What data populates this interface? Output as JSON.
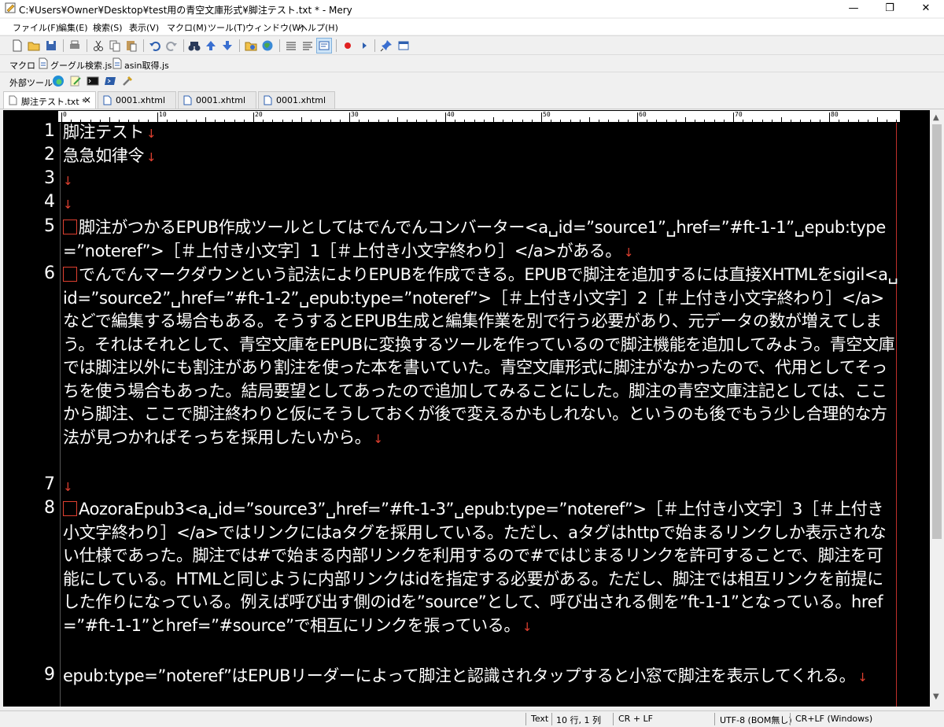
{
  "window": {
    "title": "C:¥Users¥Owner¥Desktop¥test用の青空文庫形式¥脚注テスト.txt * - Mery",
    "minimize": "—",
    "restore": "❐",
    "close": "✕"
  },
  "menu": [
    "ファイル(F)",
    "編集(E)",
    "検索(S)",
    "表示(V)",
    "マクロ(M)",
    "ツール(T)",
    "ウィンドウ(W)",
    "ヘルプ(H)"
  ],
  "macro_bar": {
    "label": "マクロ",
    "items": [
      "グーグル検索.js",
      "asin取得.js"
    ]
  },
  "ext_bar": {
    "label": "外部ツール"
  },
  "tabs": [
    {
      "label": "脚注テスト.txt *",
      "close": "×"
    },
    {
      "label": "0001.xhtml"
    },
    {
      "label": "0001.xhtml"
    },
    {
      "label": "0001.xhtml"
    }
  ],
  "ruler": {
    "labels": [
      "0",
      "10",
      "20",
      "30",
      "40",
      "50",
      "60",
      "70",
      "80"
    ]
  },
  "eol_mark": "↓",
  "lines": [
    {
      "num": "1",
      "text": "脚注テスト"
    },
    {
      "num": "2",
      "text": "急急如律令"
    },
    {
      "num": "3",
      "text": ""
    },
    {
      "num": "4",
      "text": ""
    },
    {
      "num": "5",
      "text": "脚注がつかるEPUB作成ツールとしてはでんでんコンバーター<a␣id=”source1”␣href=”#ft-1-1”␣epub:type=”noteref”>［＃上付き小文字］1［＃上付き小文字終わり］</a>がある。"
    },
    {
      "num": "6",
      "text": "でんでんマークダウンという記法によりEPUBを作成できる。EPUBで脚注を追加するには直接XHTMLをsigil<a␣id=”source2”␣href=”#ft-1-2”␣epub:type=”noteref”>［＃上付き小文字］2［＃上付き小文字終わり］</a>などで編集する場合もある。そうするとEPUB生成と編集作業を別で行う必要があり、元データの数が増えてしまう。それはそれとして、青空文庫をEPUBに変換するツールを作っているので脚注機能を追加してみよう。青空文庫では脚注以外にも割注があり割注を使った本を書いていた。青空文庫形式に脚注がなかったので、代用としてそっちを使う場合もあった。結局要望としてあったので追加してみることにした。脚注の青空文庫注記としては、ここから脚注、ここで脚注終わりと仮にそうしておくが後で変えるかもしれない。というのも後でもう少し合理的な方法が見つかればそっちを採用したいから。"
    },
    {
      "num": "7",
      "text": ""
    },
    {
      "num": "8",
      "text": "AozoraEpub3<a␣id=”source3”␣href=”#ft-1-3”␣epub:type=”noteref”>［＃上付き小文字］3［＃上付き小文字終わり］</a>ではリンクにはaタグを採用している。ただし、aタグはhttpで始まるリンクしか表示されない仕様であった。脚注では#で始まる内部リンクを利用するので#ではじまるリンクを許可することで、脚注を可能にしている。HTMLと同じように内部リンクはidを指定する必要がある。ただし、脚注では相互リンクを前提にした作りになっている。例えば呼び出す側のidを”source”として、呼び出される側を”ft-1-1”となっている。href=”#ft-1-1”とhref=”#source”で相互にリンクを張っている。"
    },
    {
      "num": "9",
      "text": "epub:type=”noteref”はEPUBリーダーによって脚注と認識されタップすると小窓で脚注を表示してくれる。"
    }
  ],
  "status": {
    "mode": "Text",
    "position": "10 行, 1 列",
    "newline": "CR + LF",
    "encoding": "UTF-8 (BOM無し)",
    "newline_full": "CR+LF (Windows)"
  },
  "colors": {
    "editor_bg": "#000000",
    "eol": "#e04030",
    "wrap_guide": "#c0302a"
  }
}
